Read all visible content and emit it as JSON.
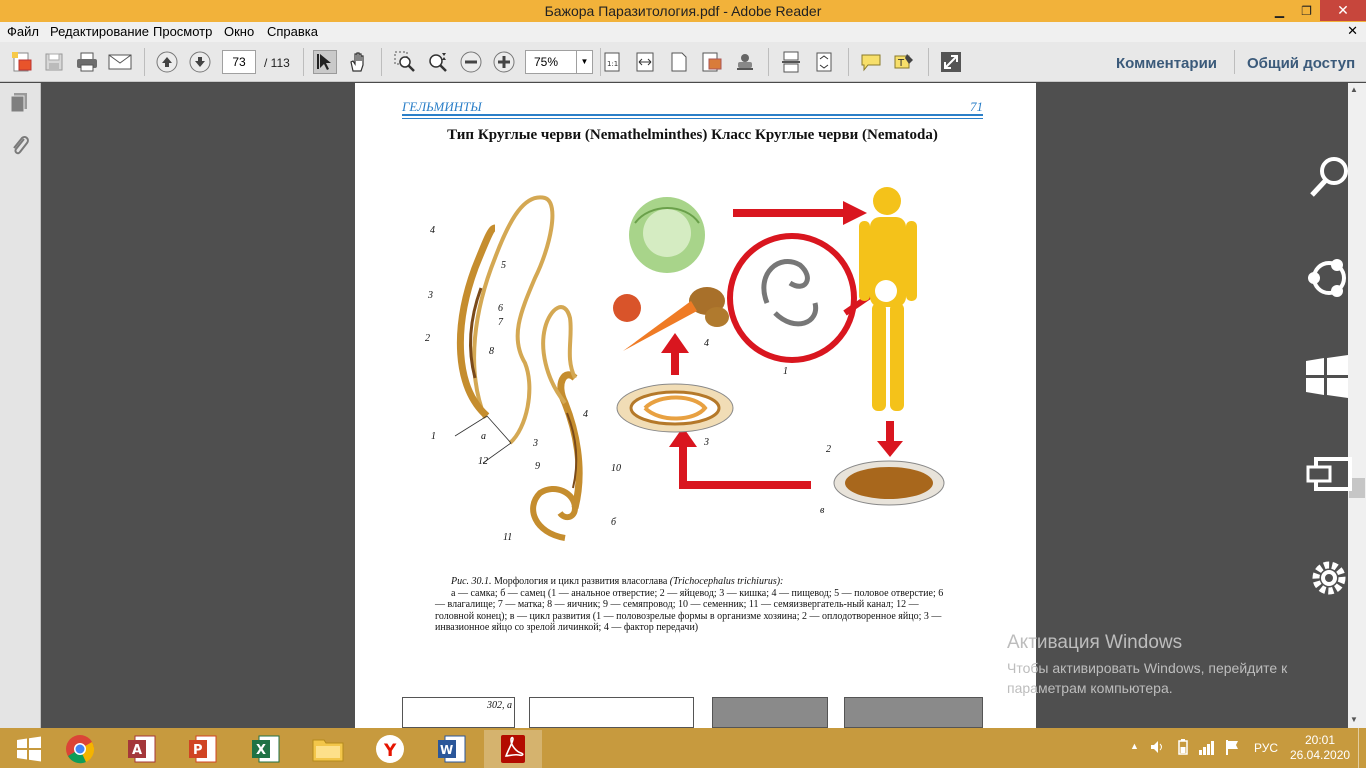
{
  "window": {
    "title": "Бажора Паразитология.pdf - Adobe Reader",
    "minimize_glyph": "▁",
    "restore_glyph": "❐",
    "close_glyph": "✕"
  },
  "menu": {
    "items": [
      "Файл",
      "Редактирование",
      "Просмотр",
      "Окно",
      "Справка"
    ],
    "close_glyph": "✕"
  },
  "toolbar": {
    "current_page": "73",
    "total_pages": "/ 113",
    "zoom": "75%",
    "comments_label": "Комментарии",
    "share_label": "Общий доступ"
  },
  "document": {
    "running_head": "ГЕЛЬМИНТЫ",
    "page_number": "71",
    "title": "Тип Круглые черви (Nemathelminthes) Класс Круглые черви (Nematoda)",
    "figure_labels": {
      "l4a": "4",
      "l5": "5",
      "l3a": "3",
      "l6": "6",
      "l7": "7",
      "l2a": "2",
      "l8": "8",
      "l1a": "1",
      "la": "а",
      "l12": "12",
      "l4b": "4",
      "l3b": "3",
      "l9": "9",
      "l10": "10",
      "l11": "11",
      "lb": "б",
      "l4c": "4",
      "l1c": "1",
      "l3c": "3",
      "l2c": "2",
      "lv": "в"
    },
    "caption": {
      "heading": "Рис. 30.1.",
      "heading_rest": " Морфология и цикл развития власоглава ",
      "species": "(Trichocephalus trichiurus):",
      "body": "а — самка; б — самец (1 — анальное отверстие; 2 — яйцевод; 3 — кишка; 4 — пищевод; 5 — половое отверстие; 6 — влагалище; 7 — матка; 8 — яичник; 9 — семяпровод; 10 — семенник; 11 — семяизвергатель-ный канал; 12 — головной конец); в — цикл развития (1 — половозрелые формы в организме хозяина; 2 — оплодотворенное яйцо; 3 — инвазионное яйцо со зрелой личинкой; 4 — фактор передачи)"
    },
    "thumb_label": "302, а"
  },
  "watermark": {
    "line1": "Активация Windows",
    "line2": "Чтобы активировать Windows, перейдите к",
    "line3": "параметрам компьютера."
  },
  "taskbar": {
    "lang": "РУС",
    "time": "20:01",
    "date": "26.04.2020"
  }
}
